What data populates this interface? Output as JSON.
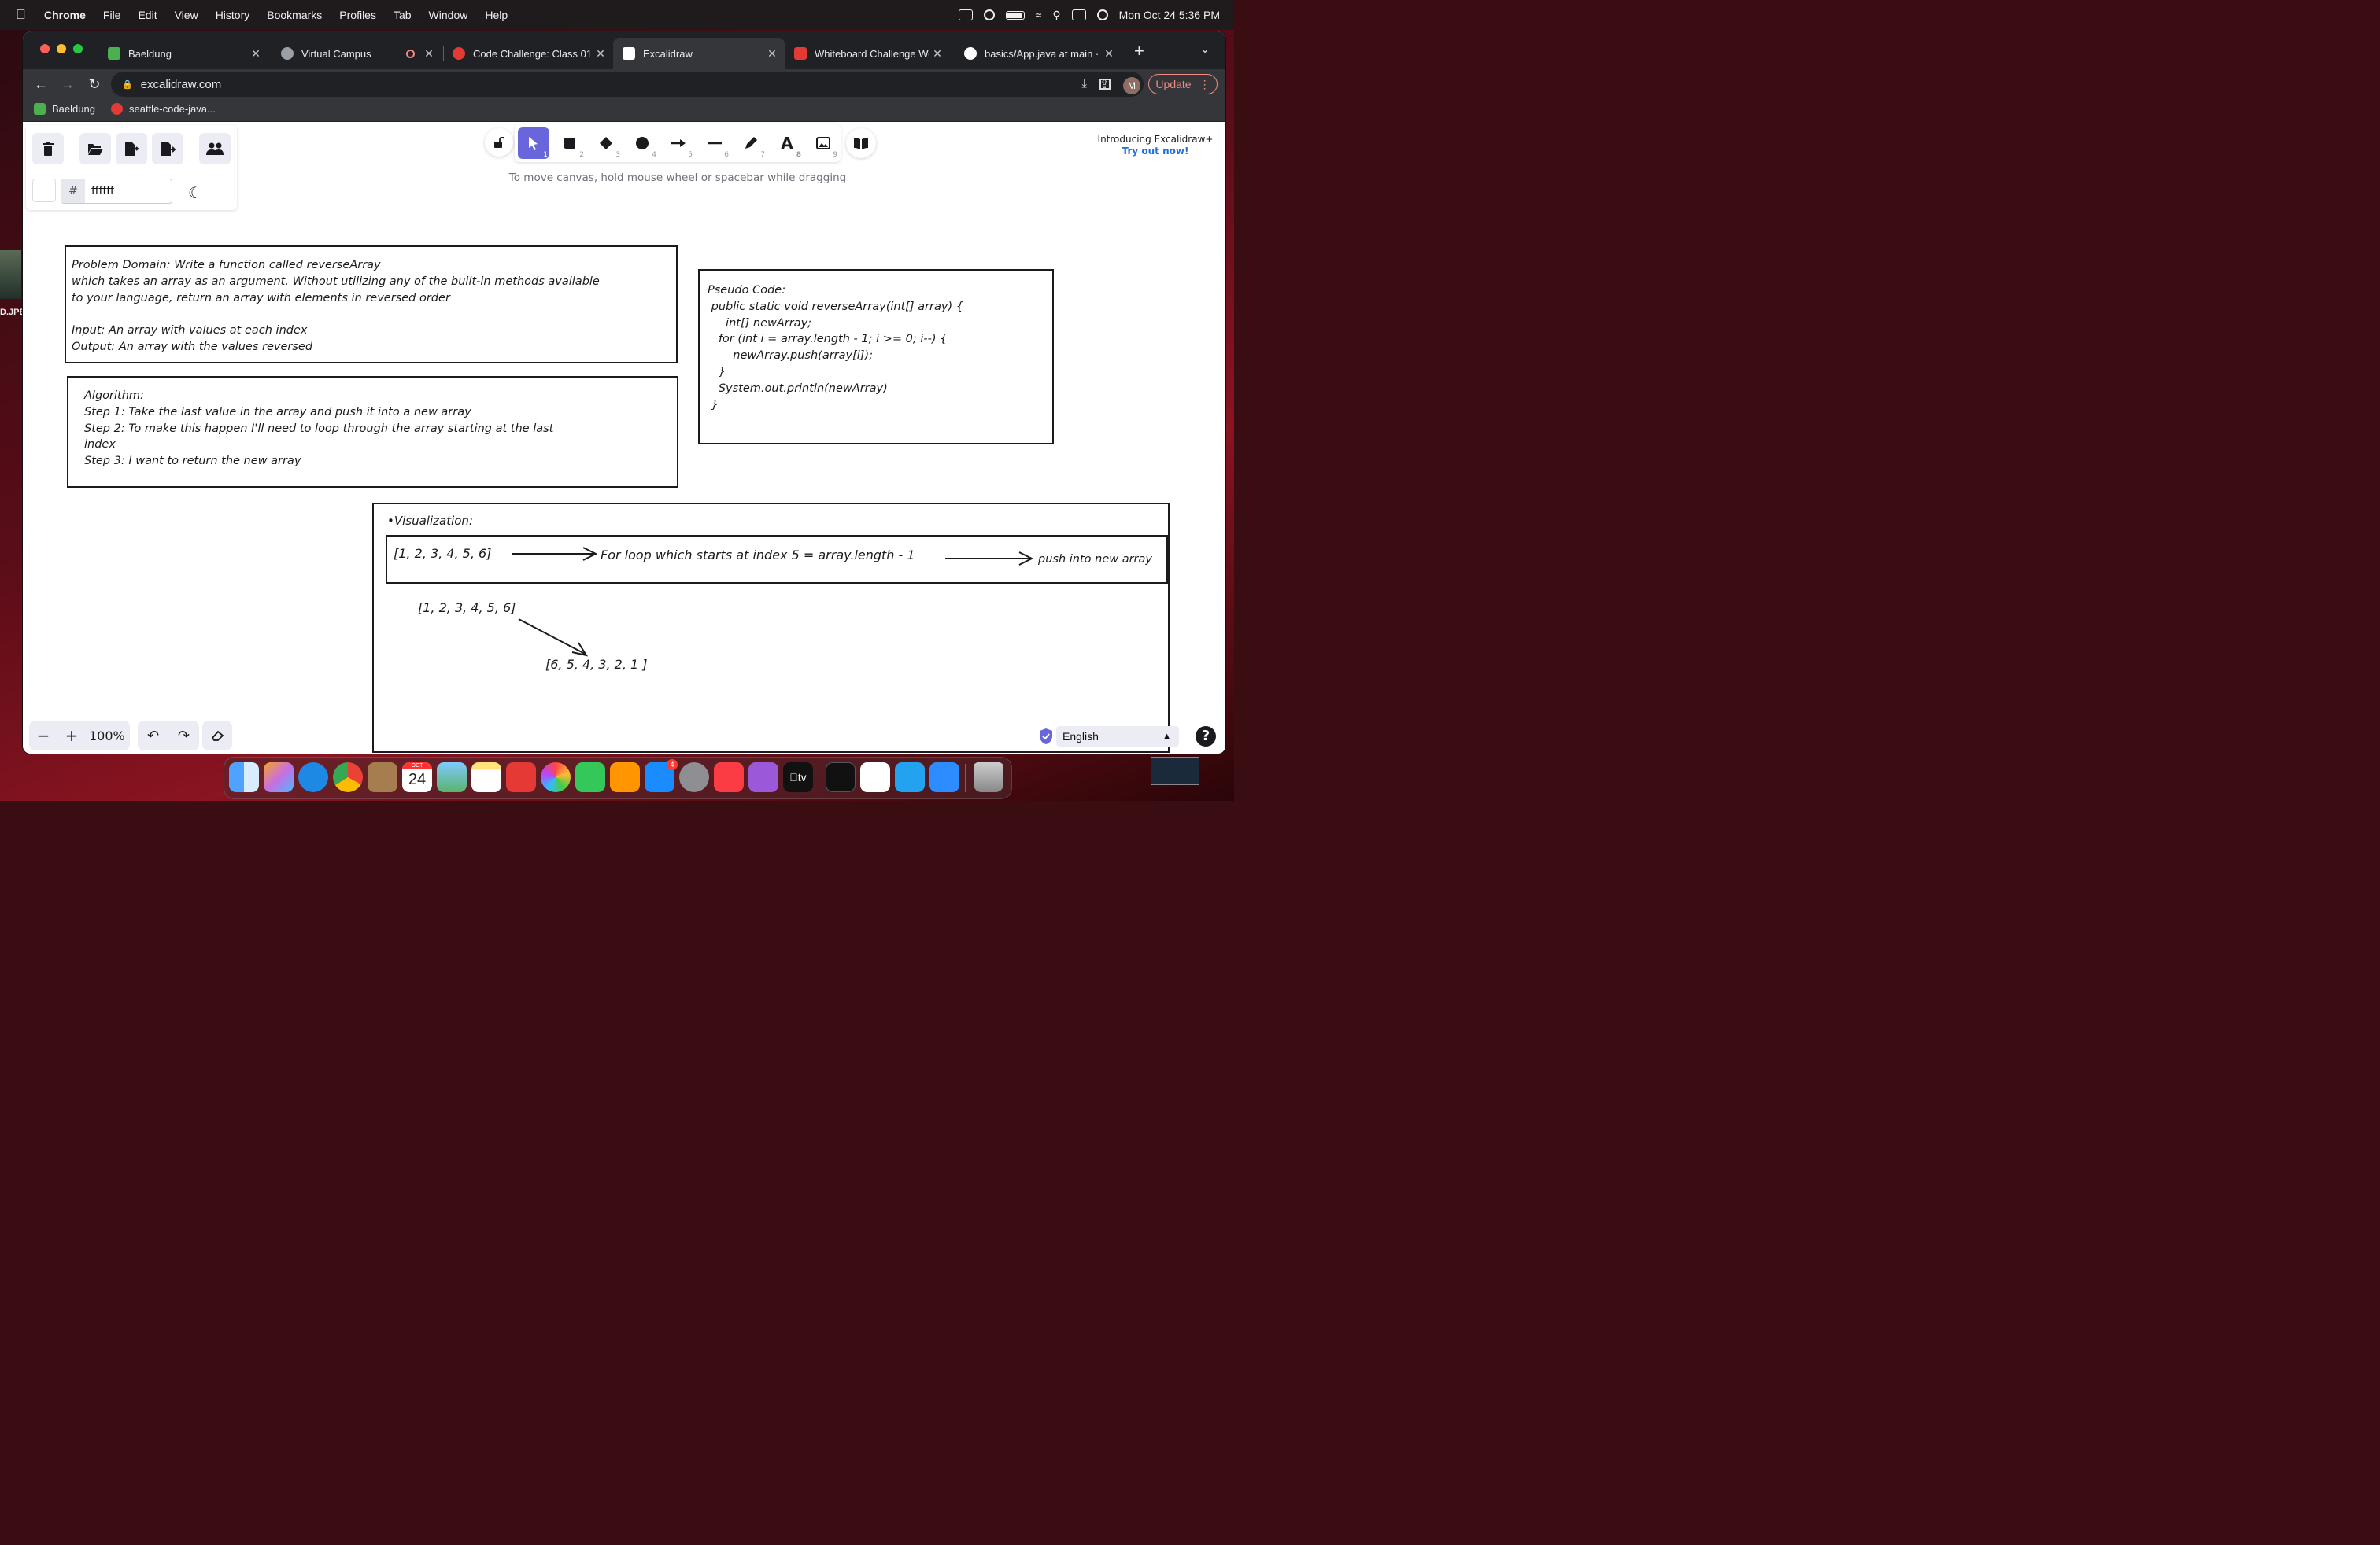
{
  "menubar": {
    "app": "Chrome",
    "items": [
      "File",
      "Edit",
      "View",
      "History",
      "Bookmarks",
      "Profiles",
      "Tab",
      "Window",
      "Help"
    ],
    "clock": "Mon Oct 24  5:36 PM"
  },
  "desktop": {
    "file_label": "D.JPE"
  },
  "tabs": [
    {
      "title": "Baeldung",
      "color": "#4caf50"
    },
    {
      "title": "Virtual Campus",
      "color": "#9aa0a6"
    },
    {
      "title": "Code Challenge: Class 01",
      "color": "#e53935"
    },
    {
      "title": "Excalidraw",
      "color": "#ffffff"
    },
    {
      "title": "Whiteboard Challenge Wo",
      "color": "#e53935"
    },
    {
      "title": "basics/App.java at main ·",
      "color": "#ffffff"
    }
  ],
  "address": {
    "url": "excalidraw.com",
    "avatar_initial": "M",
    "update_label": "Update"
  },
  "bookmarks": [
    {
      "title": "Baeldung",
      "color": "#4caf50"
    },
    {
      "title": "seattle-code-java...",
      "color": "#e53935"
    }
  ],
  "editor": {
    "bg_hex": "ffffff",
    "hash": "#",
    "tool_keys": [
      "1",
      "2",
      "3",
      "4",
      "5",
      "6",
      "7",
      "8",
      "9"
    ],
    "hint": "To move canvas, hold mouse wheel or spacebar while dragging",
    "promo_title": "Introducing Excalidraw+",
    "promo_link": "Try out now!",
    "zoom": "100%",
    "language": "English",
    "help": "?"
  },
  "drawing": {
    "problem": "Problem Domain: Write a function called reverseArray\nwhich takes an array as an argument. Without utilizing any of the built-in methods available\nto your language, return an array with elements in reversed order\n\nInput: An array with values at each index\nOutput: An array with the values reversed",
    "algorithm": "Algorithm:\nStep 1: Take the last value in the array and push it into a new array\nStep 2: To make this happen I'll need to loop through the array starting at the last\nindex\nStep 3: I want to return the new array",
    "pseudo": "Pseudo Code:\n public static void reverseArray(int[] array) {\n     int[] newArray;\n   for (int i = array.length - 1; i >= 0; i--) {\n       newArray.push(array[i]);\n   }\n   System.out.println(newArray)\n }",
    "viz_title": "•Visualization:",
    "viz_array": "[1, 2, 3, 4, 5, 6]",
    "viz_loop": "For loop which starts at index 5 = array.length - 1",
    "viz_push": "push into new array",
    "viz_input": "[1, 2, 3, 4, 5, 6]",
    "viz_output": "[6, 5, 4, 3, 2, 1 ]"
  },
  "dock": {
    "calendar_month": "OCT",
    "calendar_day": "24",
    "appstore_badge": "4",
    "tv_label": "tv"
  }
}
